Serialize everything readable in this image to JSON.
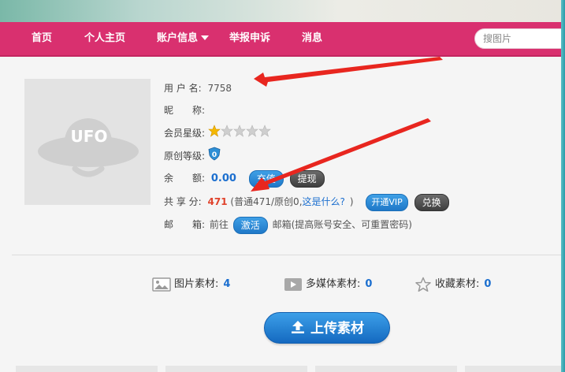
{
  "nav": {
    "items": [
      {
        "label": "首页"
      },
      {
        "label": "个人主页"
      },
      {
        "label": "账户信息"
      },
      {
        "label": "举报申诉"
      },
      {
        "label": "消息"
      }
    ],
    "search_placeholder": "搜图片"
  },
  "avatar": {
    "text": "UFO"
  },
  "profile": {
    "username_label": "用 户 名:",
    "username_value": "7758",
    "nickname_label": "昵　　称:",
    "member_level_label": "会员星级:",
    "member_stars": {
      "filled": 1,
      "total": 5
    },
    "original_level_label": "原创等级:",
    "original_level_badge": "0",
    "balance_label": "余　　额:",
    "balance_value": "0.00",
    "recharge_button": "充值",
    "withdraw_button": "提现",
    "share_label": "共 享 分:",
    "share_value": "471",
    "share_detail_open": "(普通",
    "share_normal": "471",
    "share_sep": "/原创",
    "share_original": "0",
    "share_comma": ",",
    "share_help_link": "这是什么?",
    "share_detail_close": ")",
    "vip_button": "开通VIP",
    "exchange_button": "兑换",
    "email_label": "邮　　箱:",
    "email_prefix": "前往",
    "activate_button": "激活",
    "email_suffix": "邮箱(提高账号安全、可重置密码)"
  },
  "stats": [
    {
      "label": "图片素材:",
      "count": "4",
      "icon": "image-icon"
    },
    {
      "label": "多媒体素材:",
      "count": "0",
      "icon": "media-icon"
    },
    {
      "label": "收藏素材:",
      "count": "0",
      "icon": "star-outline-icon"
    }
  ],
  "upload_button": "上传素材",
  "colors": {
    "nav_bg": "#d9306f",
    "accent_blue": "#1c6fcf",
    "share_red": "#e0432c",
    "arrow_red": "#e8261f"
  }
}
